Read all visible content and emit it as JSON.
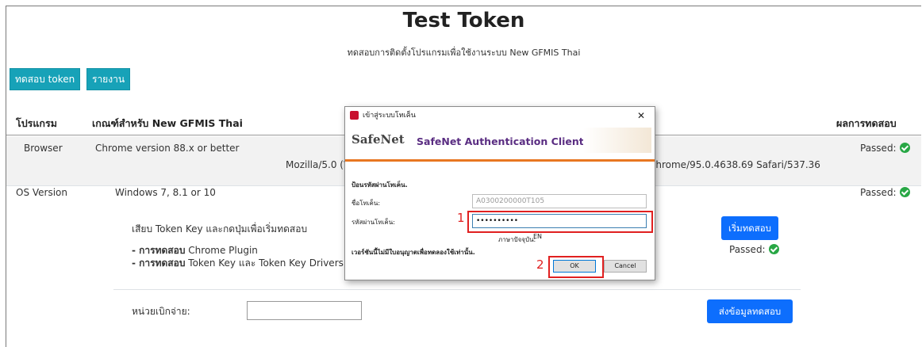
{
  "header": {
    "title": "Test Token",
    "subtitle": "ทดสอบการติดตั้งโปรแกรมเพื่อใช้งานระบบ New GFMIS Thai"
  },
  "tabs": [
    {
      "label": "ทดสอบ token"
    },
    {
      "label": "รายงาน"
    }
  ],
  "table": {
    "headers": {
      "program": "โปรแกรม",
      "criteria": "เกณฑ์สำหรับ New GFMIS Thai",
      "result": "ผลการทดสอบ"
    },
    "rows": [
      {
        "program": "Browser",
        "criteria": "Chrome version 88.x or better",
        "detected_left": "Mozilla/5.0 (W",
        "detected_right": "Chrome/95.0.4638.69 Safari/537.36",
        "result": "Passed:"
      },
      {
        "program": "OS Version",
        "criteria": "Windows 7, 8.1 or 10",
        "result": "Passed:"
      }
    ]
  },
  "token_test": {
    "instruction": "เสียบ Token Key และกดปุ่มเพื่อเริ่มทดสอบ",
    "item1_prefix": "- การทดสอบ",
    "item1_text": "Chrome Plugin",
    "item2_prefix": "- การทดสอบ",
    "item2_text": "Token Key และ Token Key Drivers",
    "start_button": "เริ่มทดสอบ",
    "result": "Passed:"
  },
  "agency": {
    "label": "หน่วยเบิกจ่าย:",
    "value": "",
    "submit_button": "ส่งข้อมูลทดสอบ"
  },
  "dialog": {
    "title": "เข้าสู่ระบบโทเค็น",
    "brand": "SafeNet",
    "product": "SafeNet Authentication Client",
    "prompt": "ป้อนรหัสผ่านโทเค็น.",
    "token_name_label": "ชื่อโทเค็น:",
    "token_name_value": "A0300200000T105",
    "password_label": "รหัสผ่านโทเค็น:",
    "password_value": "••••••••••",
    "lang_label": "ภาษาปัจจุบัน:",
    "lang_value": "EN",
    "warning": "เวอร์ชันนี้ไม่มีใบอนุญาตเพื่อทดลองใช้เท่านั้น.",
    "ok": "OK",
    "cancel": "Cancel",
    "annotation1": "1",
    "annotation2": "2"
  },
  "colors": {
    "teal": "#17a2b8",
    "blue": "#0d6efd",
    "success": "#28a745",
    "annotation_red": "#e02020",
    "safenet_orange": "#e87722"
  }
}
